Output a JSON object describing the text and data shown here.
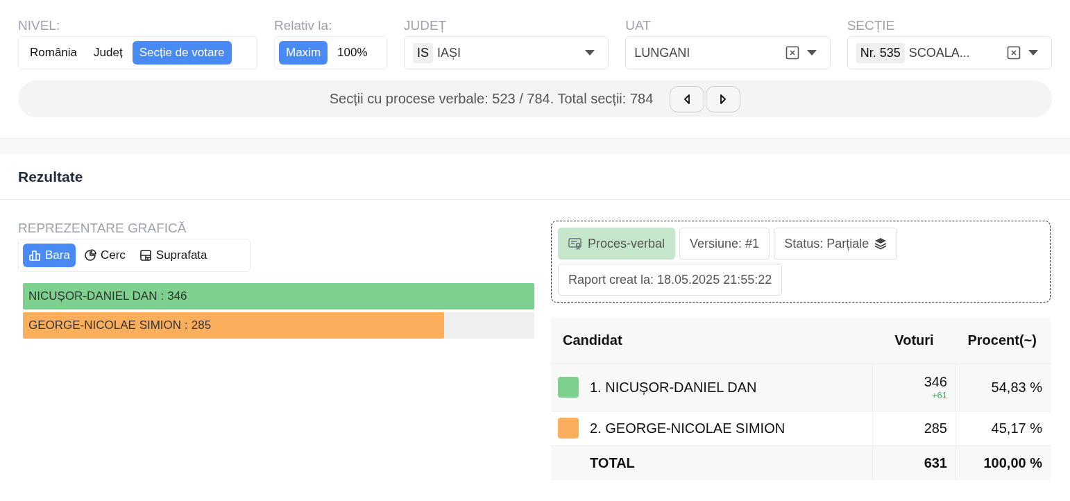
{
  "filters": {
    "nivel": {
      "label": "NIVEL:",
      "options": [
        {
          "label": "România",
          "selected": false
        },
        {
          "label": "Județ",
          "selected": false
        },
        {
          "label": "Secție de votare",
          "selected": true
        }
      ]
    },
    "relativ": {
      "label": "Relativ la:",
      "options": [
        {
          "label": "Maxim",
          "selected": true
        },
        {
          "label": "100%",
          "selected": false
        }
      ]
    },
    "judet": {
      "label": "JUDEȚ",
      "code": "IS",
      "value": "IAȘI",
      "clearable": false
    },
    "uat": {
      "label": "UAT",
      "value": "LUNGANI",
      "clearable": true
    },
    "sectie": {
      "label": "SECȚIE",
      "code": "Nr. 535",
      "value": "SCOALA...",
      "clearable": true
    }
  },
  "stats": {
    "text": "Secții cu procese verbale: 523 / 784. Total secții: 784"
  },
  "results": {
    "title": "Rezultate",
    "chart_section": {
      "label": "REPREZENTARE GRAFICĂ",
      "options": [
        {
          "label": "Bara",
          "kind": "bar",
          "selected": true
        },
        {
          "label": "Cerc",
          "kind": "pie",
          "selected": false
        },
        {
          "label": "Suprafata",
          "kind": "area",
          "selected": false
        }
      ],
      "chart_data": {
        "type": "bar",
        "orientation": "horizontal",
        "categories": [
          "NICUȘOR-DANIEL DAN",
          "GEORGE-NICOLAE SIMION"
        ],
        "data_labels": true,
        "annotations": [
          {
            "text": ":"
          },
          {
            "text": ":"
          }
        ],
        "series": [
          {
            "values": [
              346,
              285
            ],
            "colors": [
              "#7ed08f",
              "#fbae5c"
            ]
          }
        ]
      }
    },
    "report": {
      "tags": [
        {
          "kind": "doc",
          "label": "Proces-verbal"
        },
        {
          "kind": "plain",
          "label": "Versiune: #1"
        },
        {
          "kind": "status",
          "label": "Status: Parțiale"
        },
        {
          "kind": "plain",
          "label": "Raport creat la: 18.05.2025 21:55:22"
        }
      ]
    },
    "table": {
      "columns": [
        "Candidat",
        "Voturi",
        "Procent(~)"
      ],
      "rows": [
        {
          "color": "#7ed08f",
          "name": "1. NICUȘOR-DANIEL DAN",
          "votes": "346",
          "delta": "+61",
          "percent": "54,83 %"
        },
        {
          "color": "#fbae5c",
          "name": "2. GEORGE-NICOLAE SIMION",
          "votes": "285",
          "percent": "45,17 %"
        }
      ],
      "total": {
        "label": "TOTAL",
        "votes": "631",
        "percent": "100,00 %"
      }
    }
  }
}
